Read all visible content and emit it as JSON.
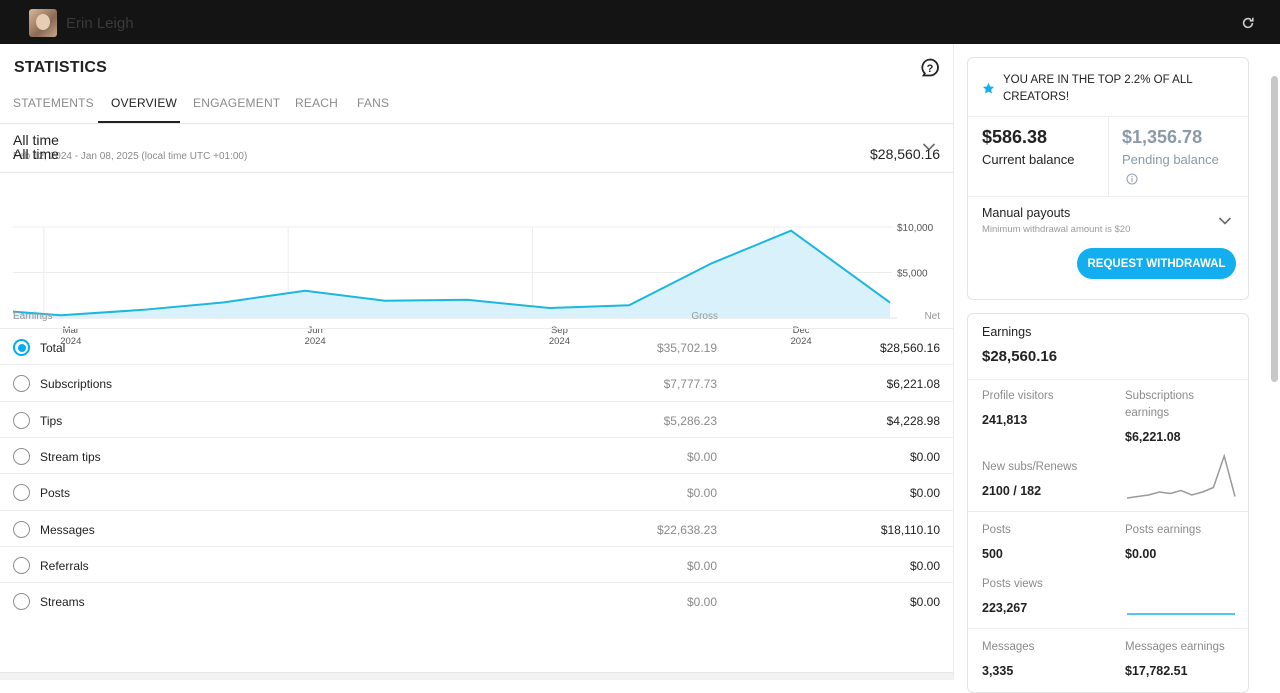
{
  "header": {
    "username": "Erin Leigh"
  },
  "page": {
    "title": "STATISTICS"
  },
  "tabs": [
    "STATEMENTS",
    "OVERVIEW",
    "ENGAGEMENT",
    "REACH",
    "FANS"
  ],
  "active_tab": "OVERVIEW",
  "period": {
    "title": "All time",
    "range": "Feb 12, 2024 - Jan 08, 2025 (local time UTC +01:00)"
  },
  "chart_header": {
    "label": "All time",
    "total": "$28,560.16"
  },
  "chart_data": {
    "type": "area",
    "x": [
      "2024-02-12",
      "2024-03-01",
      "2024-04-01",
      "2024-05-01",
      "2024-06-01",
      "2024-07-01",
      "2024-08-01",
      "2024-09-01",
      "2024-10-01",
      "2024-11-01",
      "2024-12-01",
      "2025-01-01"
    ],
    "y": [
      700,
      300,
      900,
      1700,
      3000,
      1900,
      2000,
      1100,
      1400,
      6000,
      9600,
      1700
    ],
    "ylim": [
      0,
      10000
    ],
    "yticks": [
      {
        "value": 10000,
        "label": "$10,000"
      },
      {
        "value": 5000,
        "label": "$5,000"
      }
    ],
    "xticks": [
      {
        "value": "2024-03-01",
        "month": "Mar",
        "year": "2024"
      },
      {
        "value": "2024-06-01",
        "month": "Jun",
        "year": "2024"
      },
      {
        "value": "2024-09-01",
        "month": "Sep",
        "year": "2024"
      },
      {
        "value": "2024-12-01",
        "month": "Dec",
        "year": "2024"
      }
    ],
    "x_end": "2025-01-08",
    "color": "#1cb6e0",
    "fill": "#d9f1fb",
    "grid": true
  },
  "table": {
    "headers": {
      "label": "Earnings",
      "gross": "Gross",
      "net": "Net"
    },
    "rows": [
      {
        "label": "Total",
        "gross": "$35,702.19",
        "net": "$28,560.16",
        "selected": true
      },
      {
        "label": "Subscriptions",
        "gross": "$7,777.73",
        "net": "$6,221.08",
        "selected": false
      },
      {
        "label": "Tips",
        "gross": "$5,286.23",
        "net": "$4,228.98",
        "selected": false
      },
      {
        "label": "Stream tips",
        "gross": "$0.00",
        "net": "$0.00",
        "selected": false
      },
      {
        "label": "Posts",
        "gross": "$0.00",
        "net": "$0.00",
        "selected": false
      },
      {
        "label": "Messages",
        "gross": "$22,638.23",
        "net": "$18,110.10",
        "selected": false
      },
      {
        "label": "Referrals",
        "gross": "$0.00",
        "net": "$0.00",
        "selected": false
      },
      {
        "label": "Streams",
        "gross": "$0.00",
        "net": "$0.00",
        "selected": false
      }
    ]
  },
  "sidebar": {
    "top_creator": "YOU ARE IN THE TOP 2.2% OF ALL CREATORS!",
    "current_balance": {
      "amount": "$586.38",
      "label": "Current balance"
    },
    "pending_balance": {
      "amount": "$1,356.78",
      "label": "Pending balance"
    },
    "payouts": {
      "title": "Manual payouts",
      "subtitle": "Minimum withdrawal amount is $20"
    },
    "withdraw_button": "REQUEST WITHDRAWAL",
    "earnings": {
      "title": "Earnings",
      "total": "$28,560.16",
      "profile_visitors": {
        "label": "Profile visitors",
        "value": "241,813"
      },
      "subscriptions_earnings": {
        "label": "Subscriptions earnings",
        "value": "$6,221.08"
      },
      "new_subs": {
        "label": "New subs/Renews",
        "value": "2100 / 182"
      },
      "posts": {
        "label": "Posts",
        "value": "500"
      },
      "posts_earnings": {
        "label": "Posts earnings",
        "value": "$0.00"
      },
      "posts_views": {
        "label": "Posts views",
        "value": "223,267"
      },
      "messages": {
        "label": "Messages",
        "value": "3,335"
      },
      "messages_earnings": {
        "label": "Messages earnings",
        "value": "$17,782.51"
      }
    },
    "sparkline_subs": [
      2,
      3,
      4,
      6,
      5,
      7,
      4,
      6,
      9,
      30,
      3
    ],
    "sparkline_posts": [
      1,
      1,
      1,
      1,
      1,
      1,
      1,
      1,
      1,
      1,
      1
    ]
  },
  "colors": {
    "accent": "#00aff0",
    "topbar": "#141414"
  }
}
